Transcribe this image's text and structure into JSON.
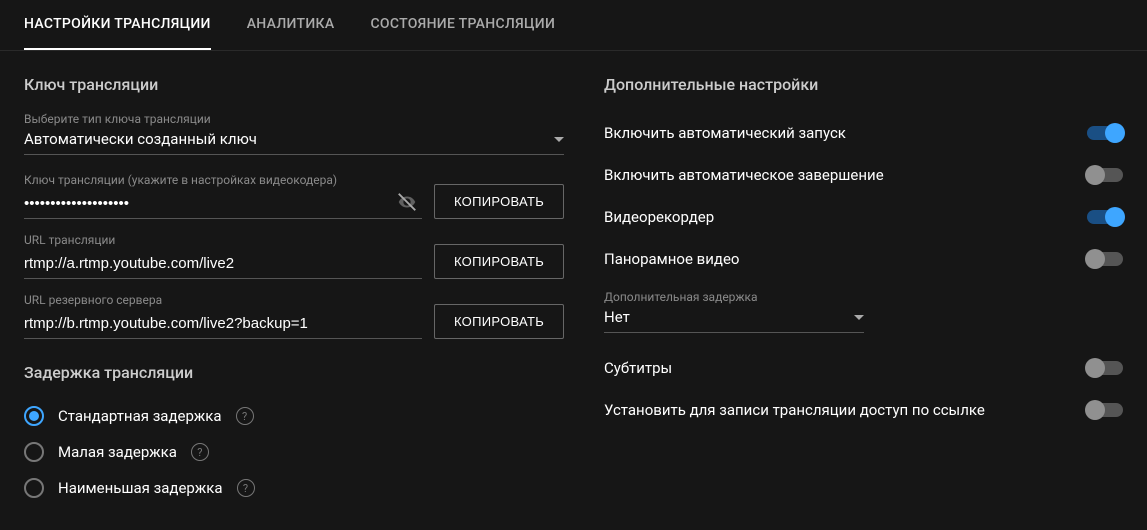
{
  "tabs": {
    "settings": "НАСТРОЙКИ ТРАНСЛЯЦИИ",
    "analytics": "АНАЛИТИКА",
    "health": "СОСТОЯНИЕ ТРАНСЛЯЦИИ"
  },
  "stream_key": {
    "title": "Ключ трансляции",
    "key_type_label": "Выберите тип ключа трансляции",
    "key_type_value": "Автоматически созданный ключ",
    "key_label": "Ключ трансляции (укажите в настройках видеокодера)",
    "key_value": "••••••••••••••••••••",
    "url_label": "URL трансляции",
    "url_value": "rtmp://a.rtmp.youtube.com/live2",
    "backup_label": "URL резервного сервера",
    "backup_value": "rtmp://b.rtmp.youtube.com/live2?backup=1",
    "copy_label": "КОПИРОВАТЬ"
  },
  "latency": {
    "title": "Задержка трансляции",
    "options": [
      "Стандартная задержка",
      "Малая задержка",
      "Наименьшая задержка"
    ],
    "selected": 0
  },
  "additional": {
    "title": "Дополнительные настройки",
    "auto_start": "Включить автоматический запуск",
    "auto_stop": "Включить автоматическое завершение",
    "dvr": "Видеорекордер",
    "pano": "Панорамное видео",
    "delay_label": "Дополнительная задержка",
    "delay_value": "Нет",
    "captions": "Субтитры",
    "unlisted": "Установить для записи трансляции доступ по ссылке"
  }
}
